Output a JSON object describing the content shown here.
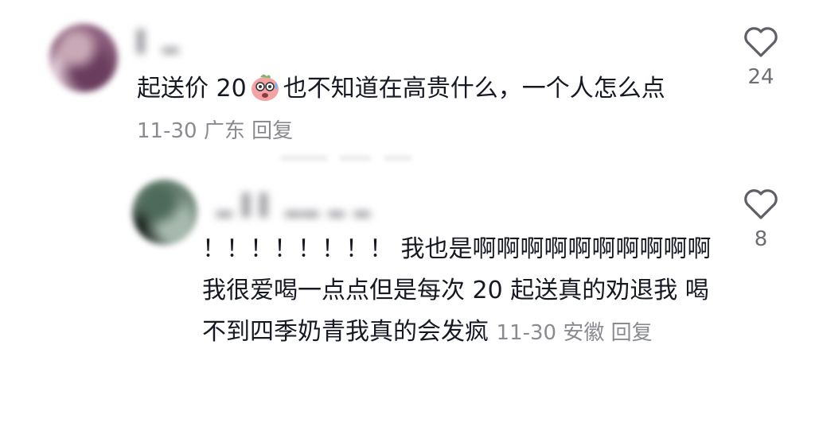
{
  "comments": [
    {
      "text_before_emoji": "起送价 20",
      "emoji": "sweating-peach-emoji",
      "text_after_emoji": "也不知道在高贵什么，一个人怎么点",
      "date": "11-30",
      "location": "广东",
      "reply_label": "回复",
      "like_count": "24"
    },
    {
      "text": "！！！！！！！！ 我也是啊啊啊啊啊啊啊啊啊啊 我很爱喝一点点但是每次 20 起送真的劝退我 喝不到四季奶青我真的会发疯",
      "date": "11-30",
      "location": "安徽",
      "reply_label": "回复",
      "like_count": "8"
    }
  ],
  "colors": {
    "text": "#161823",
    "meta": "#8a8b91",
    "icon": "#5f6067"
  }
}
